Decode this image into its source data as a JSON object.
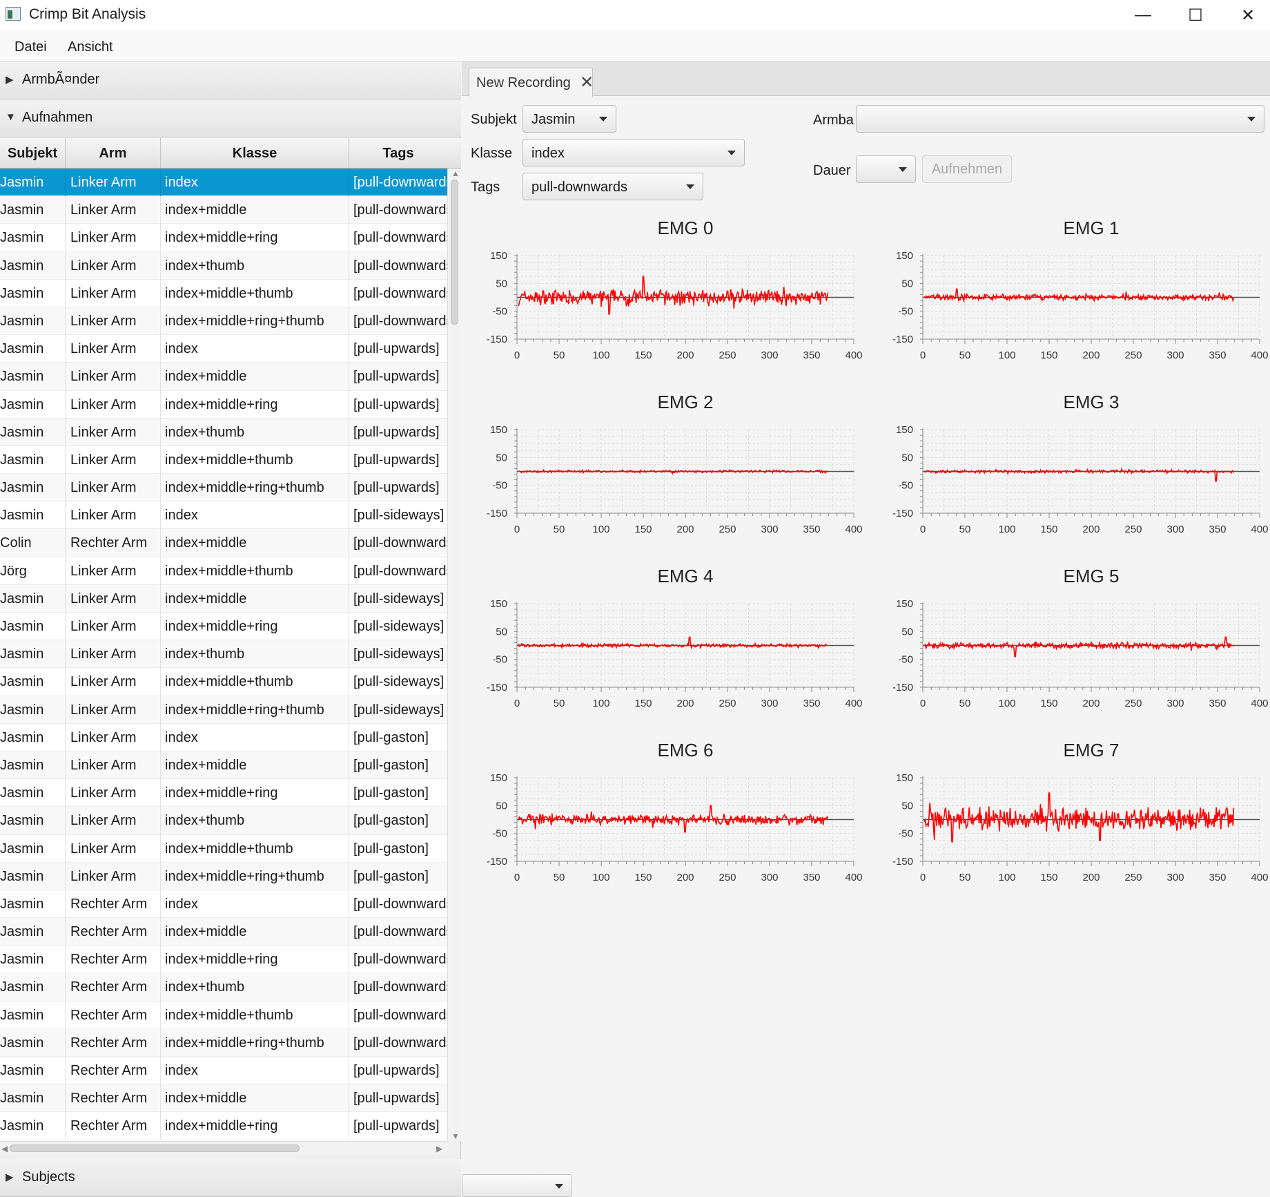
{
  "window": {
    "title": "Crimp Bit Analysis",
    "minimize": "—",
    "maximize": "☐",
    "close": "✕"
  },
  "menu": {
    "items": [
      "Datei",
      "Ansicht"
    ]
  },
  "left": {
    "panes": {
      "armbaender": "ArmbÃ¤nder",
      "aufnahmen": "Aufnahmen",
      "subjects": "Subjects"
    },
    "columns": [
      "Subjekt",
      "Arm",
      "Klasse",
      "Tags"
    ],
    "rows": [
      [
        "Jasmin",
        "Linker Arm",
        "index",
        "[pull-downwards]"
      ],
      [
        "Jasmin",
        "Linker Arm",
        "index+middle",
        "[pull-downwards]"
      ],
      [
        "Jasmin",
        "Linker Arm",
        "index+middle+ring",
        "[pull-downwards]"
      ],
      [
        "Jasmin",
        "Linker Arm",
        "index+thumb",
        "[pull-downwards]"
      ],
      [
        "Jasmin",
        "Linker Arm",
        "index+middle+thumb",
        "[pull-downwards]"
      ],
      [
        "Jasmin",
        "Linker Arm",
        "index+middle+ring+thumb",
        "[pull-downwards]"
      ],
      [
        "Jasmin",
        "Linker Arm",
        "index",
        "[pull-upwards]"
      ],
      [
        "Jasmin",
        "Linker Arm",
        "index+middle",
        "[pull-upwards]"
      ],
      [
        "Jasmin",
        "Linker Arm",
        "index+middle+ring",
        "[pull-upwards]"
      ],
      [
        "Jasmin",
        "Linker Arm",
        "index+thumb",
        "[pull-upwards]"
      ],
      [
        "Jasmin",
        "Linker Arm",
        "index+middle+thumb",
        "[pull-upwards]"
      ],
      [
        "Jasmin",
        "Linker Arm",
        "index+middle+ring+thumb",
        "[pull-upwards]"
      ],
      [
        "Jasmin",
        "Linker Arm",
        "index",
        "[pull-sideways]"
      ],
      [
        "Colin",
        "Rechter Arm",
        "index+middle",
        "[pull-downwards]"
      ],
      [
        "Jörg",
        "Linker Arm",
        "index+middle+thumb",
        "[pull-downwards]"
      ],
      [
        "Jasmin",
        "Linker Arm",
        "index+middle",
        "[pull-sideways]"
      ],
      [
        "Jasmin",
        "Linker Arm",
        "index+middle+ring",
        "[pull-sideways]"
      ],
      [
        "Jasmin",
        "Linker Arm",
        "index+thumb",
        "[pull-sideways]"
      ],
      [
        "Jasmin",
        "Linker Arm",
        "index+middle+thumb",
        "[pull-sideways]"
      ],
      [
        "Jasmin",
        "Linker Arm",
        "index+middle+ring+thumb",
        "[pull-sideways]"
      ],
      [
        "Jasmin",
        "Linker Arm",
        "index",
        "[pull-gaston]"
      ],
      [
        "Jasmin",
        "Linker Arm",
        "index+middle",
        "[pull-gaston]"
      ],
      [
        "Jasmin",
        "Linker Arm",
        "index+middle+ring",
        "[pull-gaston]"
      ],
      [
        "Jasmin",
        "Linker Arm",
        "index+thumb",
        "[pull-gaston]"
      ],
      [
        "Jasmin",
        "Linker Arm",
        "index+middle+thumb",
        "[pull-gaston]"
      ],
      [
        "Jasmin",
        "Linker Arm",
        "index+middle+ring+thumb",
        "[pull-gaston]"
      ],
      [
        "Jasmin",
        "Rechter Arm",
        "index",
        "[pull-downwards]"
      ],
      [
        "Jasmin",
        "Rechter Arm",
        "index+middle",
        "[pull-downwards]"
      ],
      [
        "Jasmin",
        "Rechter Arm",
        "index+middle+ring",
        "[pull-downwards]"
      ],
      [
        "Jasmin",
        "Rechter Arm",
        "index+thumb",
        "[pull-downwards]"
      ],
      [
        "Jasmin",
        "Rechter Arm",
        "index+middle+thumb",
        "[pull-downwards]"
      ],
      [
        "Jasmin",
        "Rechter Arm",
        "index+middle+ring+thumb",
        "[pull-downwards]"
      ],
      [
        "Jasmin",
        "Rechter Arm",
        "index",
        "[pull-upwards]"
      ],
      [
        "Jasmin",
        "Rechter Arm",
        "index+middle",
        "[pull-upwards]"
      ],
      [
        "Jasmin",
        "Rechter Arm",
        "index+middle+ring",
        "[pull-upwards]"
      ]
    ],
    "selected_row": 0
  },
  "tab": {
    "label": "New Recording",
    "close": "✕"
  },
  "form": {
    "subjekt_label": "Subjekt",
    "subjekt_value": "Jasmin",
    "klasse_label": "Klasse",
    "klasse_value": "index",
    "tags_label": "Tags",
    "tags_value": "pull-downwards",
    "armband_label": "Armba",
    "armband_value": "",
    "dauer_label": "Dauer",
    "dauer_value": "",
    "record_button": "Aufnehmen"
  },
  "colors": {
    "selection": "#0996d1",
    "signal": "#ff0000"
  },
  "chart_data": [
    {
      "type": "line",
      "title": "EMG 0",
      "xlim": [
        0,
        400
      ],
      "ylim": [
        -150,
        150
      ],
      "xticks": [
        0,
        50,
        100,
        150,
        200,
        250,
        300,
        350,
        400
      ],
      "yticks": [
        150,
        50,
        -50,
        -150
      ],
      "amplitude": 30,
      "spikes": [
        [
          150,
          75
        ],
        [
          110,
          -60
        ]
      ],
      "x_end": 370,
      "grid": true
    },
    {
      "type": "line",
      "title": "EMG 1",
      "xlim": [
        0,
        400
      ],
      "ylim": [
        -150,
        150
      ],
      "xticks": [
        0,
        50,
        100,
        150,
        200,
        250,
        300,
        350,
        400
      ],
      "yticks": [
        150,
        50,
        -50,
        -150
      ],
      "amplitude": 12,
      "spikes": [
        [
          40,
          30
        ]
      ],
      "x_end": 370,
      "grid": true
    },
    {
      "type": "line",
      "title": "EMG 2",
      "xlim": [
        0,
        400
      ],
      "ylim": [
        -150,
        150
      ],
      "xticks": [
        0,
        50,
        100,
        150,
        200,
        250,
        300,
        350,
        400
      ],
      "yticks": [
        150,
        50,
        -50,
        -150
      ],
      "amplitude": 5,
      "spikes": [],
      "x_end": 370,
      "grid": true
    },
    {
      "type": "line",
      "title": "EMG 3",
      "xlim": [
        0,
        400
      ],
      "ylim": [
        -150,
        150
      ],
      "xticks": [
        0,
        50,
        100,
        150,
        200,
        250,
        300,
        350,
        400
      ],
      "yticks": [
        150,
        50,
        -50,
        -150
      ],
      "amplitude": 6,
      "spikes": [
        [
          348,
          -35
        ]
      ],
      "x_end": 370,
      "grid": true
    },
    {
      "type": "line",
      "title": "EMG 4",
      "xlim": [
        0,
        400
      ],
      "ylim": [
        -150,
        150
      ],
      "xticks": [
        0,
        50,
        100,
        150,
        200,
        250,
        300,
        350,
        400
      ],
      "yticks": [
        150,
        50,
        -50,
        -150
      ],
      "amplitude": 7,
      "spikes": [
        [
          205,
          -50
        ],
        [
          205,
          30
        ]
      ],
      "x_end": 370,
      "grid": true
    },
    {
      "type": "line",
      "title": "EMG 5",
      "xlim": [
        0,
        400
      ],
      "ylim": [
        -150,
        150
      ],
      "xticks": [
        0,
        50,
        100,
        150,
        200,
        250,
        300,
        350,
        400
      ],
      "yticks": [
        150,
        50,
        -50,
        -150
      ],
      "amplitude": 12,
      "spikes": [
        [
          110,
          -40
        ],
        [
          360,
          30
        ]
      ],
      "x_end": 370,
      "grid": true
    },
    {
      "type": "line",
      "title": "EMG 6",
      "xlim": [
        0,
        400
      ],
      "ylim": [
        -150,
        150
      ],
      "xticks": [
        0,
        50,
        100,
        150,
        200,
        250,
        300,
        350,
        400
      ],
      "yticks": [
        150,
        50,
        -50,
        -150
      ],
      "amplitude": 20,
      "spikes": [
        [
          200,
          -45
        ],
        [
          230,
          50
        ]
      ],
      "x_end": 370,
      "grid": true
    },
    {
      "type": "line",
      "title": "EMG 7",
      "xlim": [
        0,
        400
      ],
      "ylim": [
        -150,
        150
      ],
      "xticks": [
        0,
        50,
        100,
        150,
        200,
        250,
        300,
        350,
        400
      ],
      "yticks": [
        150,
        50,
        -50,
        -150
      ],
      "amplitude": 45,
      "spikes": [
        [
          150,
          95
        ],
        [
          35,
          -80
        ],
        [
          210,
          -75
        ]
      ],
      "x_end": 370,
      "grid": true
    }
  ]
}
